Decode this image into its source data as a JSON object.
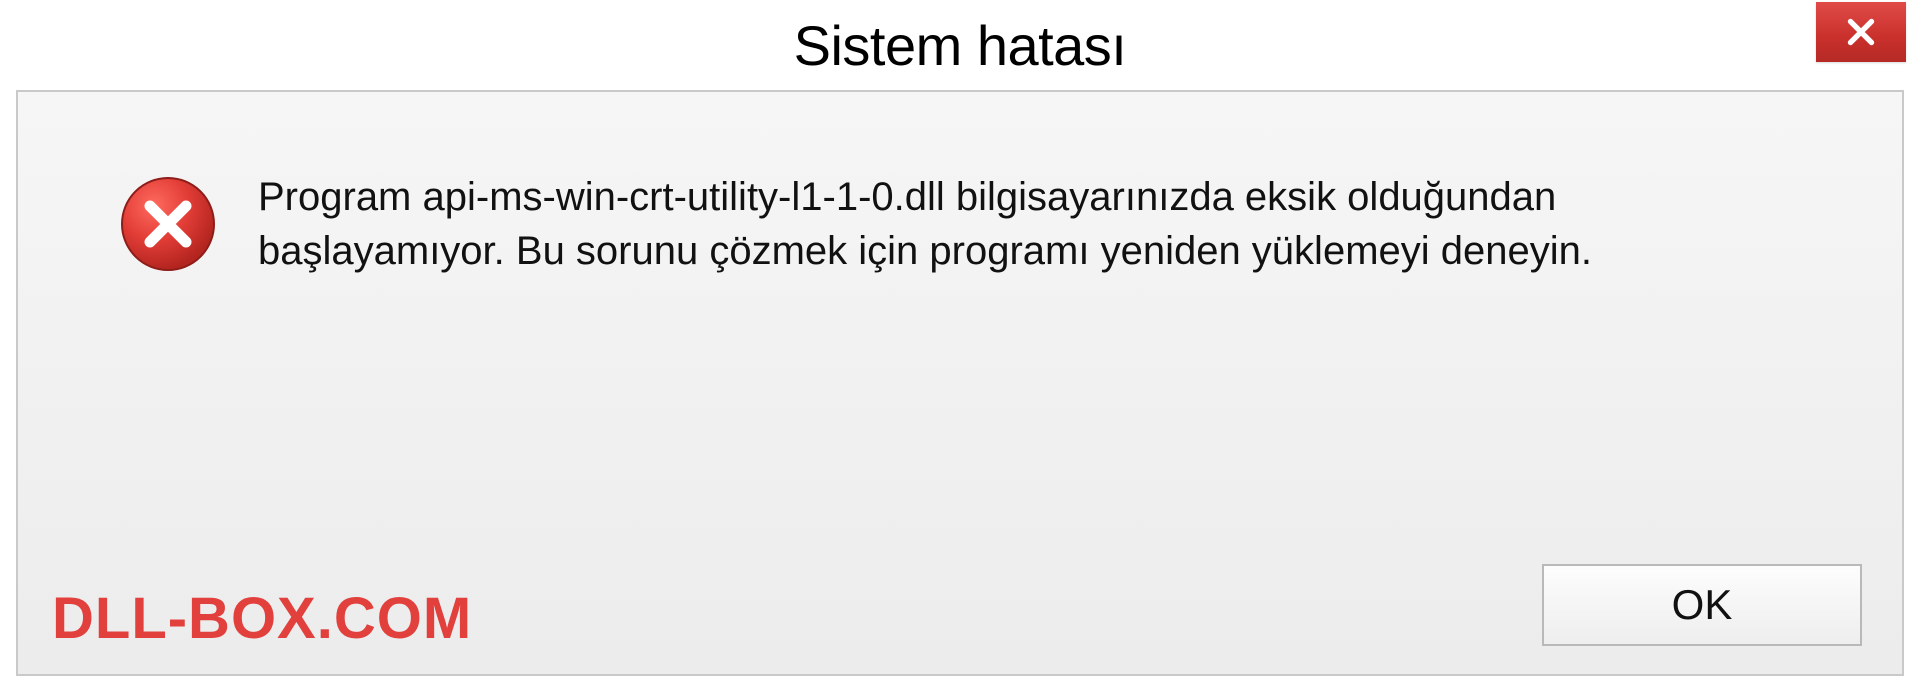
{
  "title": "Sistem hatası",
  "message": "Program api-ms-win-crt-utility-l1-1-0.dll bilgisayarınızda eksik olduğundan başlayamıyor. Bu sorunu çözmek için programı yeniden yüklemeyi deneyin.",
  "watermark": "DLL-BOX.COM",
  "buttons": {
    "ok": "OK"
  },
  "colors": {
    "close_bg": "#c9302c",
    "watermark": "#e2403c",
    "panel_border": "#c9c9c9"
  }
}
